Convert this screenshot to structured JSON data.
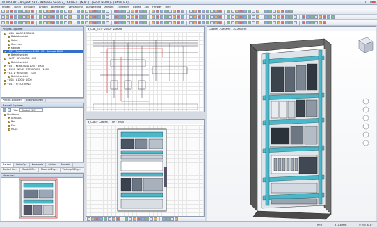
{
  "window": {
    "title": "WSCAD · Projekt: SP1 · Aktuelle Seite 3_CABINET · [MAC] · [SPEICHERN] · [ANSICHT]"
  },
  "menu": [
    "Projekt",
    "Datei",
    "Einfügen",
    "Ändern",
    "Bearbeiten",
    "Verwaltung",
    "Auswertung",
    "Ansicht",
    "Einstellen",
    "Extras",
    "Zoll",
    "Fenster",
    "Hilfe"
  ],
  "explorer": {
    "header": "Projekt-Explorer",
    "rows": [
      "+ASB · WAGO ERDUNG",
      "Betriebsmittel",
      "Kabel",
      "Klemmen",
      "Kabinet",
      "+KST · Schaltschrank 2000 · PE · Schrank 1000",
      "Betriebsmittel",
      "+WGT · KEYBOARD 1000",
      "Betriebsmittel",
      "+A51 · KEYBOARD 1000 · 1000",
      "+E100 · NEUE · STEUERUNG · 1000",
      "+E111 · RESERVE · 1000",
      "Betriebsmittel",
      "+ASR · A1004 · 1000",
      "+A41 · STEUERUNG"
    ],
    "selected_index": 5,
    "tabs": [
      "Projekt-Explorer",
      "Eigenschaften"
    ]
  },
  "filter_panel": {
    "header": "Bauteil-Explorer",
    "filter_label": "Filter",
    "filter_value": "Bauteil NEU",
    "rows": [
      "Strukturen",
      "A-MEDIA",
      "Box",
      "Flat",
      "MCSE"
    ],
    "tabs": [
      "Bauteil",
      "Verknüpf.",
      "Kategorie",
      "Aktion",
      "Bemerk."
    ],
    "subtabs": [
      "Bauteil Ver...",
      "Bauteil Bi...",
      "Material Erg...",
      "Verknüpft Erg..."
    ]
  },
  "preview": {
    "header": "Vorschau"
  },
  "schematic": {
    "tab": "3_CAB_EXT · 2000 · VARIAN"
  },
  "layout2d": {
    "tab": "3_CABI · CABINET · FR · 2000"
  },
  "view3d": {
    "header": "Cabinet - Gesamt - 3D-Ansicht"
  },
  "status": {
    "left": "",
    "items": [
      "RFH",
      "372,8 mm",
      "0 MM, X 1 °"
    ]
  },
  "colors": {
    "accent": "#3470c8",
    "cabinet": "#5a5a5a",
    "rail": "#4bb8c9"
  }
}
